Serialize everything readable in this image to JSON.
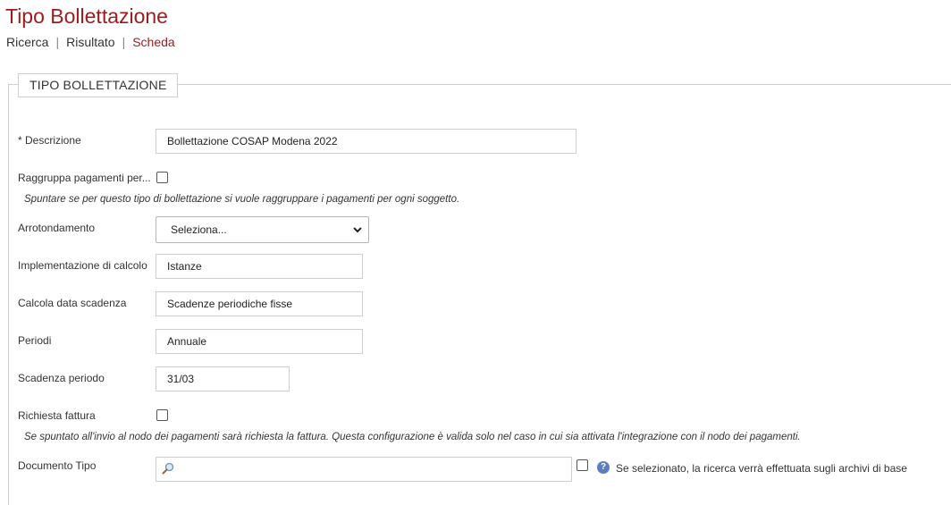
{
  "page": {
    "title": "Tipo Bollettazione"
  },
  "breadcrumb": {
    "items": [
      "Ricerca",
      "Risultato",
      "Scheda"
    ],
    "separator": "|"
  },
  "form": {
    "legend": "TIPO BOLLETTAZIONE",
    "descrizione": {
      "label": "* Descrizione",
      "value": "Bollettazione COSAP Modena 2022"
    },
    "raggruppa": {
      "label": "Raggruppa pagamenti per...",
      "checked": false,
      "hint": "Spuntare se per questo tipo di bollettazione si vuole raggruppare i pagamenti per ogni soggetto."
    },
    "arrotondamento": {
      "label": "Arrotondamento",
      "selected": "Seleziona..."
    },
    "implementazione": {
      "label": "Implementazione di calcolo",
      "value": "Istanze"
    },
    "calcola_data": {
      "label": "Calcola data scadenza",
      "value": "Scadenze periodiche fisse"
    },
    "periodi": {
      "label": "Periodi",
      "value": "Annuale"
    },
    "scadenza_periodo": {
      "label": "Scadenza periodo",
      "value": "31/03"
    },
    "richiesta_fattura": {
      "label": "Richiesta fattura",
      "checked": false,
      "hint": "Se spuntato all'invio al nodo dei pagamenti sarà richiesta la fattura. Questa configurazione è valida solo nel caso in cui sia attivata l'integrazione con il nodo dei pagamenti."
    },
    "documento_tipo": {
      "label": "Documento Tipo",
      "value": "",
      "archive_checked": false,
      "info_text": "Se selezionato, la ricerca verrà effettuata sugli archivi di base"
    }
  },
  "icons": {
    "search": "search-icon",
    "info": "info-icon",
    "dropdown": "chevron-down-icon"
  },
  "colors": {
    "accent": "#9b1c1f",
    "info": "#5a7fc1"
  }
}
